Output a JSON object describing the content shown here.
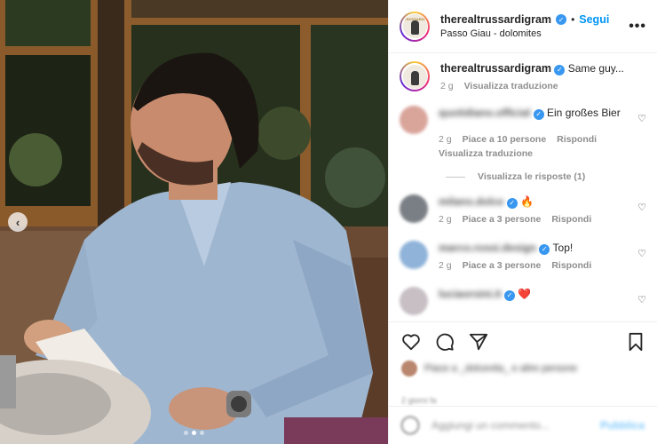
{
  "header": {
    "username": "therealtrussardigram",
    "follow_label": "Segui",
    "location": "Passo Giau - dolomites",
    "more_label": "•••",
    "separator": "•",
    "avatar_text": "TRUSSARDI"
  },
  "caption": {
    "username": "therealtrussardigram",
    "text": "Same guy...",
    "time": "2 g",
    "translate": "Visualizza traduzione"
  },
  "comments": [
    {
      "username": "quotidiano.official",
      "text": "Ein großes Bier",
      "time": "2 g",
      "likes": "Piace a 10 persone",
      "reply": "Rispondi",
      "translate": "Visualizza traduzione",
      "avatar_color": "#d9a59b"
    },
    {
      "username": "milano.dolce",
      "text": "🔥",
      "time": "2 g",
      "likes": "Piace a 3 persone",
      "reply": "Rispondi",
      "avatar_color": "#7a7f85"
    },
    {
      "username": "marco.rossi.design",
      "text": "Top!",
      "time": "2 g",
      "likes": "Piace a 3 persone",
      "reply": "Rispondi",
      "avatar_color": "#8fb3d9"
    },
    {
      "username": "luciaorsini.it",
      "text": "❤️",
      "time": "",
      "likes": "",
      "reply": "",
      "avatar_color": "#c7bfc4"
    }
  ],
  "replies_label": "Visualizza le risposte (1)",
  "likes_line": "Piace a _dolcevita_ e altre persone",
  "date": "2 giorni fa",
  "add_comment": {
    "placeholder": "Aggiungi un commento...",
    "publish": "Pubblica"
  },
  "photo": {
    "prev_label": "‹",
    "dots": 3,
    "active_dot": 1
  }
}
